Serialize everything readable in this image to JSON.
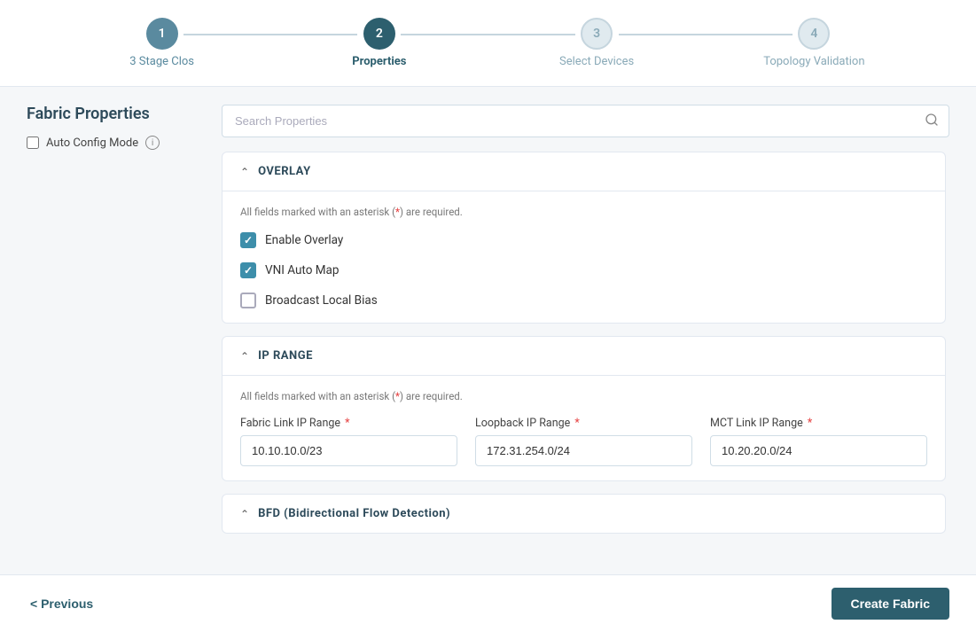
{
  "stepper": {
    "steps": [
      {
        "id": 1,
        "label": "3 Stage Clos",
        "state": "completed"
      },
      {
        "id": 2,
        "label": "Properties",
        "state": "active"
      },
      {
        "id": 3,
        "label": "Select Devices",
        "state": "inactive"
      },
      {
        "id": 4,
        "label": "Topology Validation",
        "state": "inactive"
      }
    ]
  },
  "left_panel": {
    "title": "Fabric Properties",
    "auto_config_label": "Auto Config Mode"
  },
  "search": {
    "placeholder": "Search Properties"
  },
  "sections": {
    "overlay": {
      "title": "OVERLAY",
      "required_note": "All fields marked with an asterisk (",
      "required_note_2": ") are required.",
      "checkboxes": [
        {
          "label": "Enable Overlay",
          "checked": true
        },
        {
          "label": "VNI Auto Map",
          "checked": true
        },
        {
          "label": "Broadcast Local Bias",
          "checked": false
        }
      ]
    },
    "ip_range": {
      "title": "IP RANGE",
      "required_note": "All fields marked with an asterisk (",
      "required_note_2": ") are required.",
      "fields": [
        {
          "label": "Fabric Link IP Range",
          "required": true,
          "value": "10.10.10.0/23",
          "placeholder": ""
        },
        {
          "label": "Loopback IP Range",
          "required": true,
          "value": "172.31.254.0/24",
          "placeholder": ""
        },
        {
          "label": "MCT Link IP Range",
          "required": true,
          "value": "10.20.20.0/24",
          "placeholder": ""
        }
      ]
    },
    "bfd": {
      "title": "BFD (Bidirectional Flow Detection)"
    }
  },
  "footer": {
    "prev_label": "< Previous",
    "create_label": "Create Fabric"
  },
  "colors": {
    "active_step": "#2d5f6e",
    "completed_step": "#5a8a9f",
    "checked_box": "#3d8eaa",
    "required_star": "#e53e3e"
  }
}
